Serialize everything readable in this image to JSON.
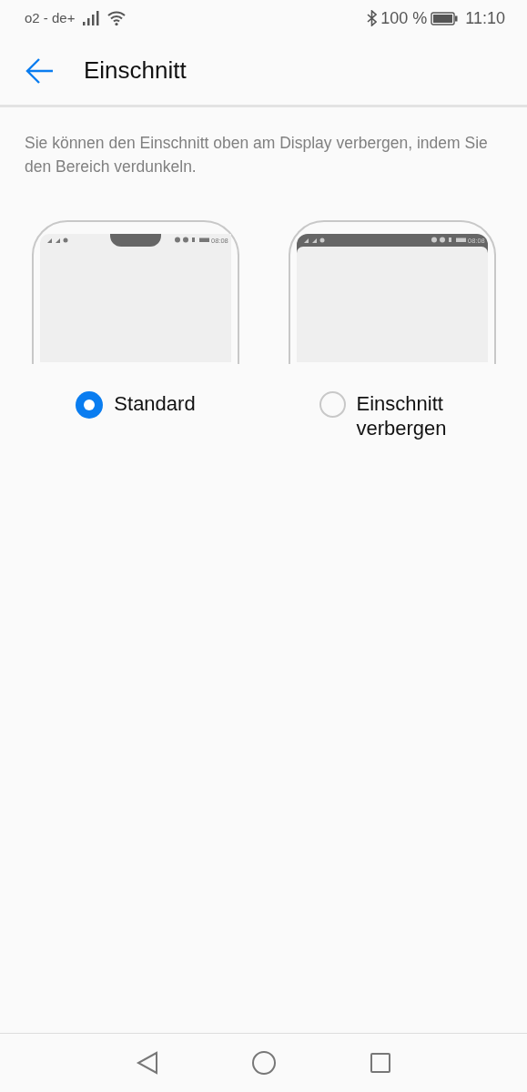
{
  "status_bar": {
    "carrier": "o2 - de+",
    "battery": "100 %",
    "time": "11:10"
  },
  "header": {
    "title": "Einschnitt"
  },
  "description": "Sie können den Einschnitt oben am Display verbergen, indem Sie den Bereich verdunkeln.",
  "options": [
    {
      "kind": "notch",
      "label": "Standard",
      "preview_time": "08:08",
      "selected": true
    },
    {
      "kind": "hidden",
      "label": "Einschnitt verbergen",
      "preview_time": "08:08",
      "selected": false
    }
  ]
}
